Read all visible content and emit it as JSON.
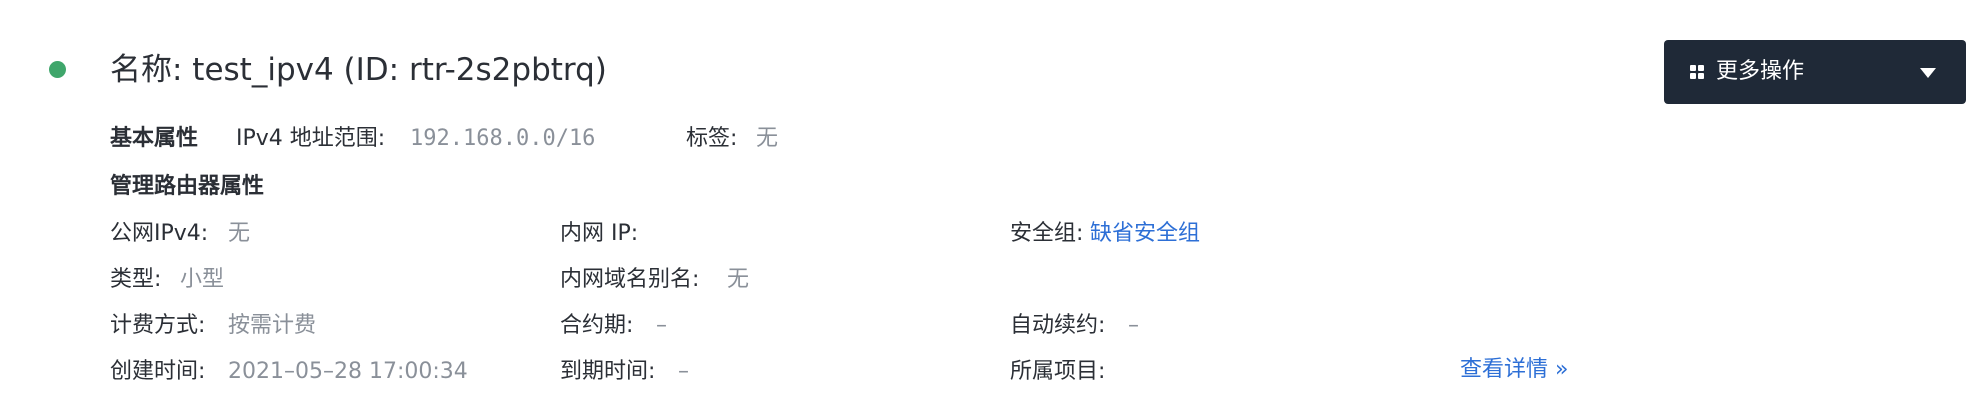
{
  "header": {
    "title": "名称: test_ipv4 (ID: rtr-2s2pbtrq)",
    "status_color": "#3fa66b",
    "more_actions_label": "更多操作"
  },
  "basic": {
    "section_label": "基本属性",
    "ipv4_range_label": "IPv4 地址范围:",
    "ipv4_range_value": "192.168.0.0/16",
    "tag_label": "标签:",
    "tag_value": "无"
  },
  "router": {
    "section_label": "管理路由器属性",
    "public_ipv4_label": "公网IPv4:",
    "public_ipv4_value": "无",
    "private_ip_label": "内网 IP:",
    "private_ip_value": "",
    "security_group_label": "安全组:",
    "security_group_link": "缺省安全组",
    "type_label": "类型:",
    "type_value": "小型",
    "private_domain_label": "内网域名别名:",
    "private_domain_value": "无",
    "billing_label": "计费方式:",
    "billing_value": "按需计费",
    "contract_label": "合约期:",
    "contract_value": "–",
    "auto_renew_label": "自动续约:",
    "auto_renew_value": "–",
    "created_label": "创建时间:",
    "created_value": "2021–05–28 17:00:34",
    "expire_label": "到期时间:",
    "expire_value": "–",
    "project_label": "所属项目:",
    "project_value": "",
    "view_details_link": "查看详情 »"
  },
  "colors": {
    "link": "#2d6fd6",
    "button_bg": "#1f2937",
    "muted": "#8a9099"
  }
}
